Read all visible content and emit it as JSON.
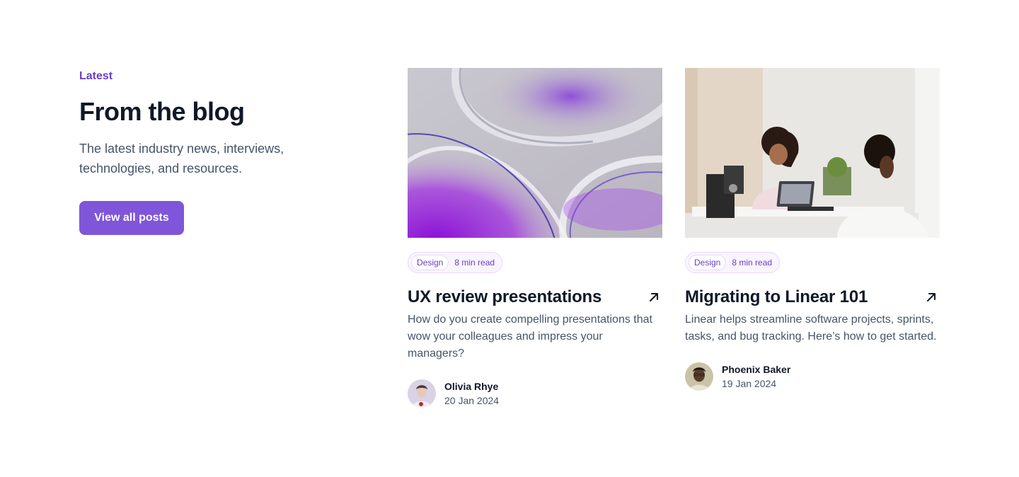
{
  "intro": {
    "eyebrow": "Latest",
    "heading": "From the blog",
    "lede": "The latest industry news, interviews, technologies, and resources.",
    "cta_label": "View all posts"
  },
  "posts": [
    {
      "tag": "Design",
      "read_time": "8 min read",
      "title": "UX review presentations",
      "description": "How do you create compelling presentations that wow your colleagues and impress your managers?",
      "author": "Olivia Rhye",
      "date": "20 Jan 2024",
      "image": "abstract-glass-shapes-image"
    },
    {
      "tag": "Design",
      "read_time": "8 min read",
      "title": "Migrating to Linear 101",
      "description": "Linear helps streamline software projects, sprints, tasks, and bug tracking. Here’s how to get started.",
      "author": "Phoenix Baker",
      "date": "19 Jan 2024",
      "image": "office-meeting-photo"
    }
  ],
  "colors": {
    "accent": "#7f56d9",
    "accent_text": "#6941c6",
    "heading": "#101828",
    "body": "#475467"
  }
}
